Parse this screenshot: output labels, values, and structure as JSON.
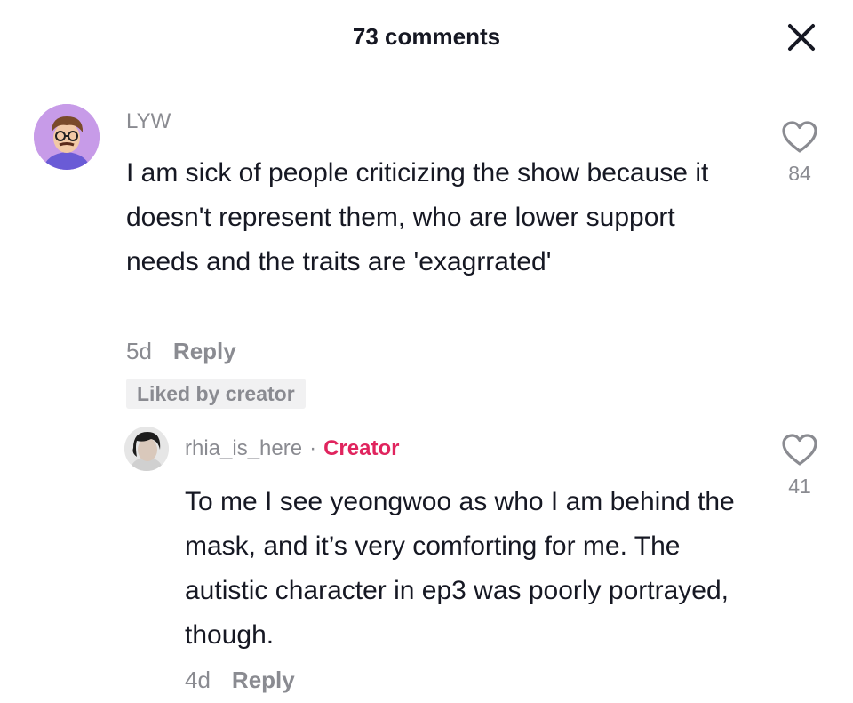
{
  "header": {
    "title": "73 comments"
  },
  "comment": {
    "username": "LYW",
    "text": "I am sick of people criticizing the show because it doesn't represent them, who are lower support needs and the traits are 'exagrrated'",
    "age": "5d",
    "reply_label": "Reply",
    "liked_badge": "Liked by creator",
    "likes": "84"
  },
  "reply": {
    "username": "rhia_is_here",
    "separator": "·",
    "creator_label": "Creator",
    "text": "To me I see yeongwoo as who I am behind the mask, and it’s very comforting for me. The autistic character in ep3 was poorly portrayed, though.",
    "age": "4d",
    "reply_label": "Reply",
    "likes": "41"
  },
  "colors": {
    "creator": "#e0245e",
    "muted": "#8a8b91",
    "text": "#161823"
  },
  "icons": {
    "close": "close-icon",
    "like": "heart-icon"
  }
}
